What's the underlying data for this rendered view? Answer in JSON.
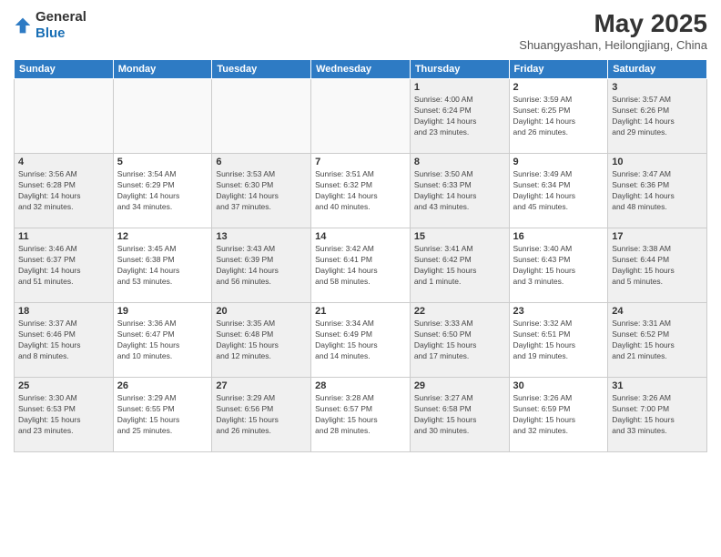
{
  "header": {
    "logo": {
      "general": "General",
      "blue": "Blue"
    },
    "month": "May 2025",
    "location": "Shuangyashan, Heilongjiang, China"
  },
  "days_of_week": [
    "Sunday",
    "Monday",
    "Tuesday",
    "Wednesday",
    "Thursday",
    "Friday",
    "Saturday"
  ],
  "weeks": [
    [
      {
        "day": "",
        "info": ""
      },
      {
        "day": "",
        "info": ""
      },
      {
        "day": "",
        "info": ""
      },
      {
        "day": "",
        "info": ""
      },
      {
        "day": "1",
        "info": "Sunrise: 4:00 AM\nSunset: 6:24 PM\nDaylight: 14 hours\nand 23 minutes."
      },
      {
        "day": "2",
        "info": "Sunrise: 3:59 AM\nSunset: 6:25 PM\nDaylight: 14 hours\nand 26 minutes."
      },
      {
        "day": "3",
        "info": "Sunrise: 3:57 AM\nSunset: 6:26 PM\nDaylight: 14 hours\nand 29 minutes."
      }
    ],
    [
      {
        "day": "4",
        "info": "Sunrise: 3:56 AM\nSunset: 6:28 PM\nDaylight: 14 hours\nand 32 minutes."
      },
      {
        "day": "5",
        "info": "Sunrise: 3:54 AM\nSunset: 6:29 PM\nDaylight: 14 hours\nand 34 minutes."
      },
      {
        "day": "6",
        "info": "Sunrise: 3:53 AM\nSunset: 6:30 PM\nDaylight: 14 hours\nand 37 minutes."
      },
      {
        "day": "7",
        "info": "Sunrise: 3:51 AM\nSunset: 6:32 PM\nDaylight: 14 hours\nand 40 minutes."
      },
      {
        "day": "8",
        "info": "Sunrise: 3:50 AM\nSunset: 6:33 PM\nDaylight: 14 hours\nand 43 minutes."
      },
      {
        "day": "9",
        "info": "Sunrise: 3:49 AM\nSunset: 6:34 PM\nDaylight: 14 hours\nand 45 minutes."
      },
      {
        "day": "10",
        "info": "Sunrise: 3:47 AM\nSunset: 6:36 PM\nDaylight: 14 hours\nand 48 minutes."
      }
    ],
    [
      {
        "day": "11",
        "info": "Sunrise: 3:46 AM\nSunset: 6:37 PM\nDaylight: 14 hours\nand 51 minutes."
      },
      {
        "day": "12",
        "info": "Sunrise: 3:45 AM\nSunset: 6:38 PM\nDaylight: 14 hours\nand 53 minutes."
      },
      {
        "day": "13",
        "info": "Sunrise: 3:43 AM\nSunset: 6:39 PM\nDaylight: 14 hours\nand 56 minutes."
      },
      {
        "day": "14",
        "info": "Sunrise: 3:42 AM\nSunset: 6:41 PM\nDaylight: 14 hours\nand 58 minutes."
      },
      {
        "day": "15",
        "info": "Sunrise: 3:41 AM\nSunset: 6:42 PM\nDaylight: 15 hours\nand 1 minute."
      },
      {
        "day": "16",
        "info": "Sunrise: 3:40 AM\nSunset: 6:43 PM\nDaylight: 15 hours\nand 3 minutes."
      },
      {
        "day": "17",
        "info": "Sunrise: 3:38 AM\nSunset: 6:44 PM\nDaylight: 15 hours\nand 5 minutes."
      }
    ],
    [
      {
        "day": "18",
        "info": "Sunrise: 3:37 AM\nSunset: 6:46 PM\nDaylight: 15 hours\nand 8 minutes."
      },
      {
        "day": "19",
        "info": "Sunrise: 3:36 AM\nSunset: 6:47 PM\nDaylight: 15 hours\nand 10 minutes."
      },
      {
        "day": "20",
        "info": "Sunrise: 3:35 AM\nSunset: 6:48 PM\nDaylight: 15 hours\nand 12 minutes."
      },
      {
        "day": "21",
        "info": "Sunrise: 3:34 AM\nSunset: 6:49 PM\nDaylight: 15 hours\nand 14 minutes."
      },
      {
        "day": "22",
        "info": "Sunrise: 3:33 AM\nSunset: 6:50 PM\nDaylight: 15 hours\nand 17 minutes."
      },
      {
        "day": "23",
        "info": "Sunrise: 3:32 AM\nSunset: 6:51 PM\nDaylight: 15 hours\nand 19 minutes."
      },
      {
        "day": "24",
        "info": "Sunrise: 3:31 AM\nSunset: 6:52 PM\nDaylight: 15 hours\nand 21 minutes."
      }
    ],
    [
      {
        "day": "25",
        "info": "Sunrise: 3:30 AM\nSunset: 6:53 PM\nDaylight: 15 hours\nand 23 minutes."
      },
      {
        "day": "26",
        "info": "Sunrise: 3:29 AM\nSunset: 6:55 PM\nDaylight: 15 hours\nand 25 minutes."
      },
      {
        "day": "27",
        "info": "Sunrise: 3:29 AM\nSunset: 6:56 PM\nDaylight: 15 hours\nand 26 minutes."
      },
      {
        "day": "28",
        "info": "Sunrise: 3:28 AM\nSunset: 6:57 PM\nDaylight: 15 hours\nand 28 minutes."
      },
      {
        "day": "29",
        "info": "Sunrise: 3:27 AM\nSunset: 6:58 PM\nDaylight: 15 hours\nand 30 minutes."
      },
      {
        "day": "30",
        "info": "Sunrise: 3:26 AM\nSunset: 6:59 PM\nDaylight: 15 hours\nand 32 minutes."
      },
      {
        "day": "31",
        "info": "Sunrise: 3:26 AM\nSunset: 7:00 PM\nDaylight: 15 hours\nand 33 minutes."
      }
    ]
  ]
}
